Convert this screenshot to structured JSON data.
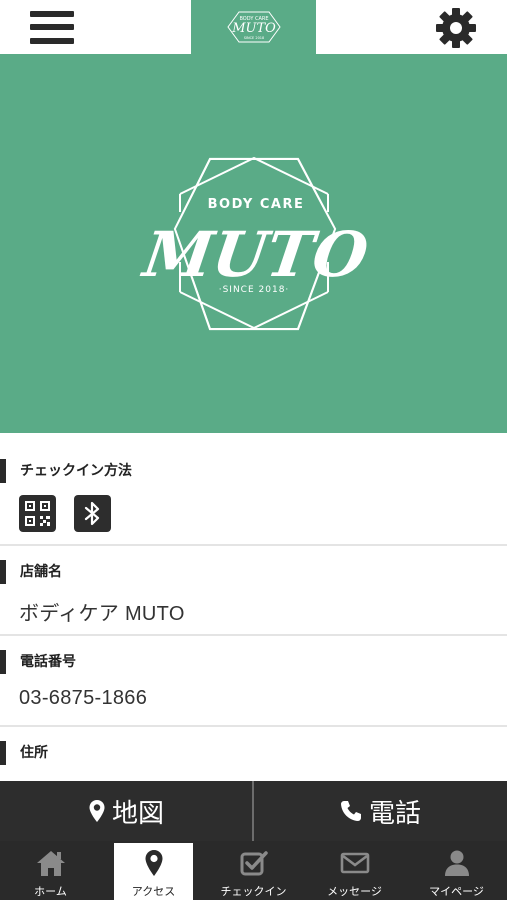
{
  "header": {
    "logo_top_text": "BODY CARE",
    "logo_main_text": "MUTO",
    "logo_bottom_text": "SINCE 2018"
  },
  "hero": {
    "top_text": "BODY CARE",
    "main_text": "MUTO",
    "bottom_text": "·SINCE 2018·"
  },
  "sections": {
    "checkin_title": "チェックイン方法",
    "shop_name_title": "店舗名",
    "shop_name_value": "ボディケア MUTO",
    "phone_title": "電話番号",
    "phone_value": "03-6875-1866",
    "address_title": "住所"
  },
  "actions": {
    "map_label": "地図",
    "tel_label": "電話"
  },
  "tabs": [
    {
      "label": "ホーム",
      "icon": "home-icon"
    },
    {
      "label": "アクセス",
      "icon": "map-pin-icon"
    },
    {
      "label": "チェックイン",
      "icon": "checkbox-icon"
    },
    {
      "label": "メッセージ",
      "icon": "envelope-icon"
    },
    {
      "label": "マイページ",
      "icon": "user-icon"
    }
  ],
  "colors": {
    "brand_green": "#5aab87",
    "dark": "#2a2a2a"
  }
}
